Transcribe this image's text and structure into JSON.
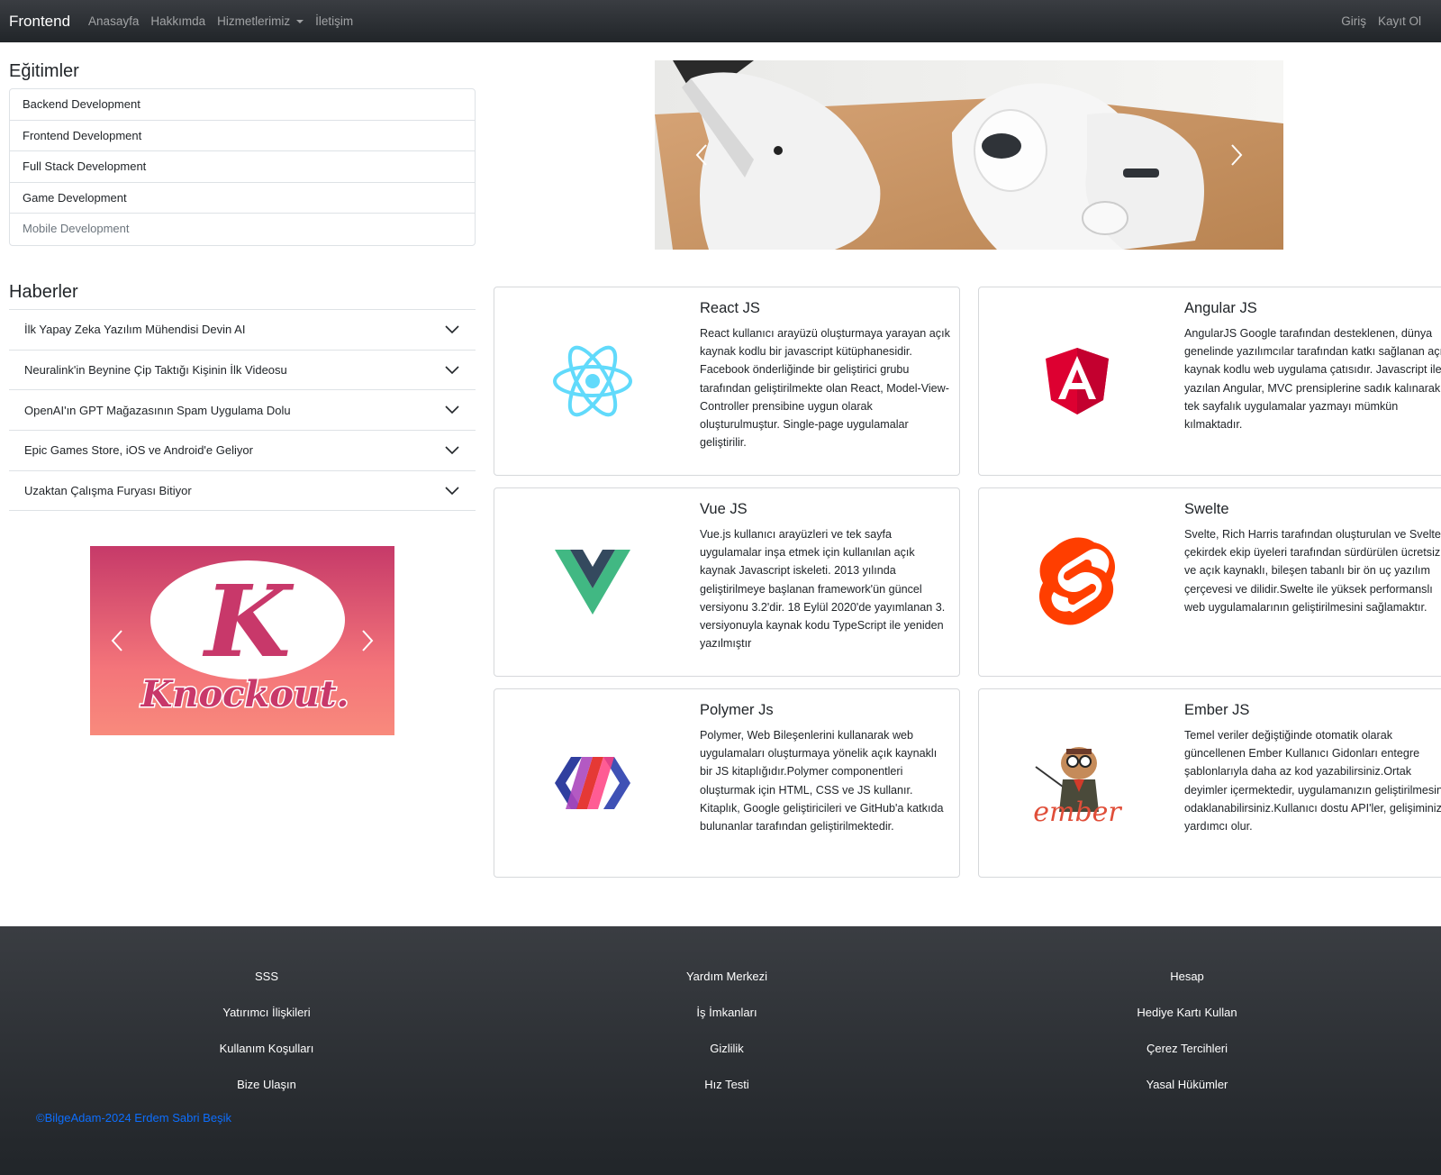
{
  "navbar": {
    "brand": "Frontend",
    "links": [
      "Anasayfa",
      "Hakkımda",
      "Hizmetlerimiz",
      "İletişim"
    ],
    "right_links": [
      "Giriş",
      "Kayıt Ol"
    ]
  },
  "egitimler": {
    "title": "Eğitimler",
    "items": [
      "Backend Development",
      "Frontend Development",
      "Full Stack Development",
      "Game Development",
      "Mobile Development"
    ]
  },
  "haberler": {
    "title": "Haberler",
    "items": [
      "İlk Yapay Zeka Yazılım Mühendisi Devin AI",
      "Neuralink'in Beynine Çip Taktığı Kişinin İlk Videosu",
      "OpenAI'ın GPT Mağazasının Spam Uygulama Dolu",
      "Epic Games Store, iOS ve Android'e Geliyor",
      "Uzaktan Çalışma Furyası Bitiyor"
    ]
  },
  "knockout_logo": {
    "letter": "K",
    "word": "Knockout."
  },
  "cards": [
    {
      "title": "React JS",
      "logo": "react-logo",
      "text": "React kullanıcı arayüzü oluşturmaya yarayan açık kaynak kodlu bir javascript kütüphanesidir. Facebook önderliğinde bir geliştirici grubu tarafından geliştirilmekte olan React, Model-View-Controller prensibine uygun olarak oluşturulmuştur. Single-page uygulamalar geliştirilir."
    },
    {
      "title": "Angular JS",
      "logo": "angular-logo",
      "text": "AngularJS Google tarafından desteklenen, dünya genelinde yazılımcılar tarafından katkı sağlanan açık kaynak kodlu web uygulama çatısıdır. Javascript ile yazılan Angular, MVC prensiplerine sadık kalınarak tek sayfalık uygulamalar yazmayı mümkün kılmaktadır."
    },
    {
      "title": "Vue JS",
      "logo": "vue-logo",
      "text": "Vue.js kullanıcı arayüzleri ve tek sayfa uygulamalar inşa etmek için kullanılan açık kaynak Javascript iskeleti. 2013 yılında geliştirilmeye başlanan framework'ün güncel versiyonu 3.2'dir. 18 Eylül 2020'de yayımlanan 3. versiyonuyla kaynak kodu TypeScript ile yeniden yazılmıştır"
    },
    {
      "title": "Swelte",
      "logo": "svelte-logo",
      "text": "Svelte, Rich Harris tarafından oluşturulan ve Svelte çekirdek ekip üyeleri tarafından sürdürülen ücretsiz ve açık kaynaklı, bileşen tabanlı bir ön uç yazılım çerçevesi ve dilidir.Swelte ile yüksek performanslı web uygulamalarının geliştirilmesini sağlamaktır."
    },
    {
      "title": "Polymer Js",
      "logo": "polymer-logo",
      "text": "Polymer, Web Bileşenlerini kullanarak web uygulamaları oluşturmaya yönelik açık kaynaklı bir JS kitaplığıdır.Polymer componentleri oluşturmak için HTML, CSS ve JS kullanır. Kitaplık, Google geliştiricileri ve GitHub'a katkıda bulunanlar tarafından geliştirilmektedir."
    },
    {
      "title": "Ember JS",
      "logo": "ember-logo",
      "logo_word": "ember",
      "text": "Temel veriler değiştiğinde otomatik olarak güncellenen Ember Kullanıcı Gidonları entegre şablonlarıyla daha az kod yazabilirsiniz.Ortak deyimler içermektedir, uygulamanızın geliştirilmesine odaklanabilirsiniz.Kullanıcı dostu API'ler, gelişiminize yardımcı olur."
    }
  ],
  "footer": {
    "columns": [
      [
        "SSS",
        "Yatırımcı İlişkileri",
        "Kullanım Koşulları",
        "Bize Ulaşın"
      ],
      [
        "Yardım Merkezi",
        "İş İmkanları",
        "Gizlilik",
        "Hız Testi"
      ],
      [
        "Hesap",
        "Hediye Kartı Kullan",
        "Çerez Tercihleri",
        "Yasal Hükümler"
      ]
    ],
    "copyright": "©BilgeAdam-2024 Erdem Sabri Beşik"
  }
}
